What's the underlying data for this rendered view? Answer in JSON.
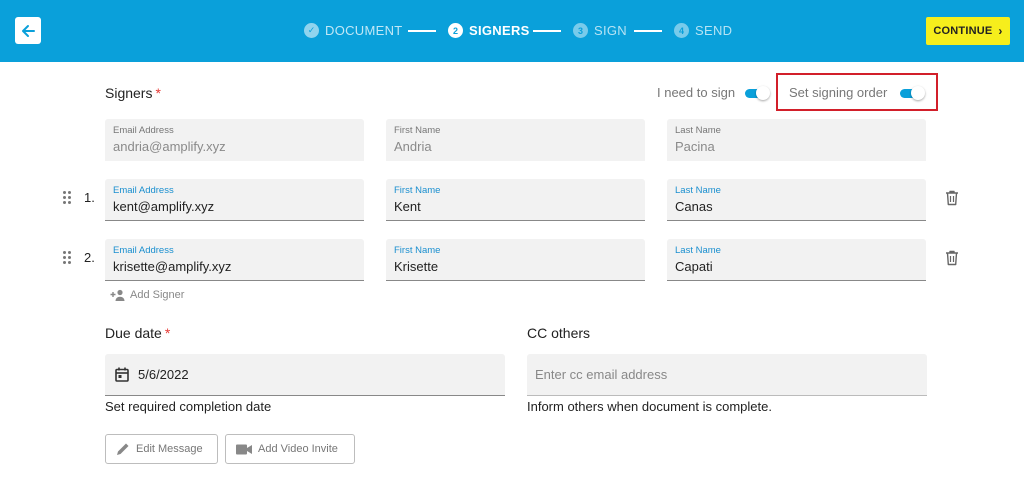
{
  "header": {
    "continue_label": "CONTINUE",
    "steps": [
      {
        "number": "✓",
        "label": "DOCUMENT",
        "state": "done"
      },
      {
        "number": "2",
        "label": "SIGNERS",
        "state": "active"
      },
      {
        "number": "3",
        "label": "SIGN",
        "state": "todo"
      },
      {
        "number": "4",
        "label": "SEND",
        "state": "todo"
      }
    ]
  },
  "signers": {
    "title": "Signers",
    "required_mark": "*",
    "i_need_to_sign_label": "I need to sign",
    "i_need_to_sign_on": true,
    "signing_order_label": "Set signing order",
    "signing_order_on": true,
    "owner": {
      "email_label": "Email Address",
      "email": "andria@amplify.xyz",
      "first_label": "First Name",
      "first": "Andria",
      "last_label": "Last Name",
      "last": "Pacina"
    },
    "rows": [
      {
        "number": "1.",
        "email_label": "Email Address",
        "email": "kent@amplify.xyz",
        "first_label": "First Name",
        "first": "Kent",
        "last_label": "Last Name",
        "last": "Canas"
      },
      {
        "number": "2.",
        "email_label": "Email Address",
        "email": "krisette@amplify.xyz",
        "first_label": "First Name",
        "first": "Krisette",
        "last_label": "Last Name",
        "last": "Capati"
      }
    ],
    "add_signer_label": "Add Signer"
  },
  "due_date": {
    "title": "Due date",
    "required_mark": "*",
    "value": "5/6/2022",
    "helper": "Set required completion date"
  },
  "cc": {
    "title": "CC others",
    "placeholder": "Enter cc email address",
    "helper": "Inform others when document is complete."
  },
  "actions": {
    "edit_message_label": "Edit Message",
    "add_video_label": "Add Video Invite"
  },
  "colors": {
    "header_blue": "#0aa0da",
    "continue_yellow": "#f6ee1c",
    "highlight_red": "#d21f2a",
    "link_blue": "#1a8fcf",
    "required_red": "#e53935"
  }
}
